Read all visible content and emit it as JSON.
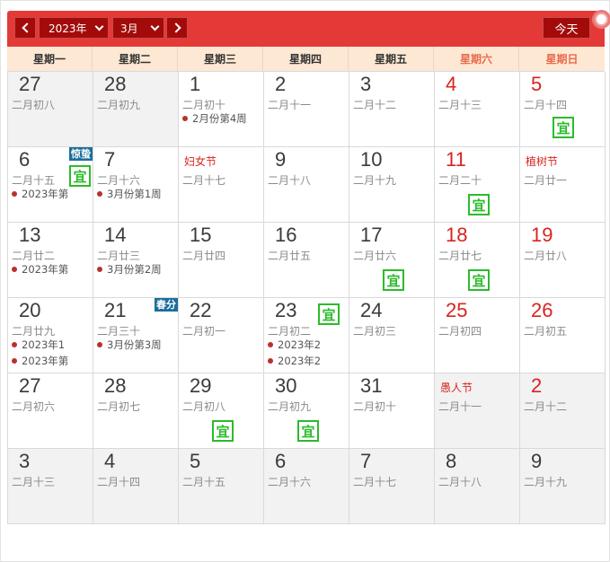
{
  "header": {
    "year_label": "2023年",
    "month_label": "3月",
    "today_label": "今天"
  },
  "weekdays": [
    "星期一",
    "星期二",
    "星期三",
    "星期四",
    "星期五",
    "星期六",
    "星期日"
  ],
  "yi_label": "宜",
  "days": [
    {
      "day": "27",
      "lunar": "二月初八",
      "other": true
    },
    {
      "day": "28",
      "lunar": "二月初九",
      "other": true
    },
    {
      "day": "1",
      "lunar": "二月初十",
      "events": [
        "2月份第4周"
      ]
    },
    {
      "day": "2",
      "lunar": "二月十一"
    },
    {
      "day": "3",
      "lunar": "二月十二"
    },
    {
      "day": "4",
      "lunar": "二月十三",
      "red": true
    },
    {
      "day": "5",
      "lunar": "二月十四",
      "red": true,
      "yi": true
    },
    {
      "day": "6",
      "lunar": "二月十五",
      "term": "惊蛰",
      "yi": true,
      "events": [
        "2023年第"
      ]
    },
    {
      "day": "7",
      "lunar": "二月十六",
      "events": [
        "3月份第1周"
      ]
    },
    {
      "day": "",
      "festival": "妇女节",
      "lunar": "二月十七"
    },
    {
      "day": "9",
      "lunar": "二月十八"
    },
    {
      "day": "10",
      "lunar": "二月十九"
    },
    {
      "day": "11",
      "lunar": "二月二十",
      "red": true,
      "yi": true
    },
    {
      "day": "",
      "festival": "植树节",
      "lunar": "二月廿一"
    },
    {
      "day": "13",
      "lunar": "二月廿二",
      "events": [
        "2023年第"
      ]
    },
    {
      "day": "14",
      "lunar": "二月廿三",
      "events": [
        "3月份第2周"
      ]
    },
    {
      "day": "15",
      "lunar": "二月廿四"
    },
    {
      "day": "16",
      "lunar": "二月廿五"
    },
    {
      "day": "17",
      "lunar": "二月廿六",
      "yi": true
    },
    {
      "day": "18",
      "lunar": "二月廿七",
      "red": true,
      "yi": true
    },
    {
      "day": "19",
      "lunar": "二月廿八",
      "red": true
    },
    {
      "day": "20",
      "lunar": "二月廿九",
      "events": [
        "2023年1",
        "2023年第"
      ]
    },
    {
      "day": "21",
      "lunar": "二月三十",
      "term": "春分",
      "events": [
        "3月份第3周"
      ]
    },
    {
      "day": "22",
      "lunar": "二月初一"
    },
    {
      "day": "23",
      "lunar": "二月初二",
      "yi": true,
      "events": [
        "2023年2",
        "2023年2"
      ]
    },
    {
      "day": "24",
      "lunar": "二月初三"
    },
    {
      "day": "25",
      "lunar": "二月初四",
      "red": true
    },
    {
      "day": "26",
      "lunar": "二月初五",
      "red": true
    },
    {
      "day": "27",
      "lunar": "二月初六"
    },
    {
      "day": "28",
      "lunar": "二月初七"
    },
    {
      "day": "29",
      "lunar": "二月初八",
      "yi": true
    },
    {
      "day": "30",
      "lunar": "二月初九",
      "yi": true
    },
    {
      "day": "31",
      "lunar": "二月初十"
    },
    {
      "day": "",
      "festival": "愚人节",
      "lunar": "二月十一",
      "other": true
    },
    {
      "day": "2",
      "lunar": "二月十二",
      "red": true,
      "other": true
    },
    {
      "day": "3",
      "lunar": "二月十三",
      "other": true
    },
    {
      "day": "4",
      "lunar": "二月十四",
      "other": true
    },
    {
      "day": "5",
      "lunar": "二月十五",
      "other": true
    },
    {
      "day": "6",
      "lunar": "二月十六",
      "other": true
    },
    {
      "day": "7",
      "lunar": "二月十七",
      "other": true
    },
    {
      "day": "8",
      "lunar": "二月十八",
      "other": true
    },
    {
      "day": "9",
      "lunar": "二月十九",
      "other": true
    }
  ]
}
